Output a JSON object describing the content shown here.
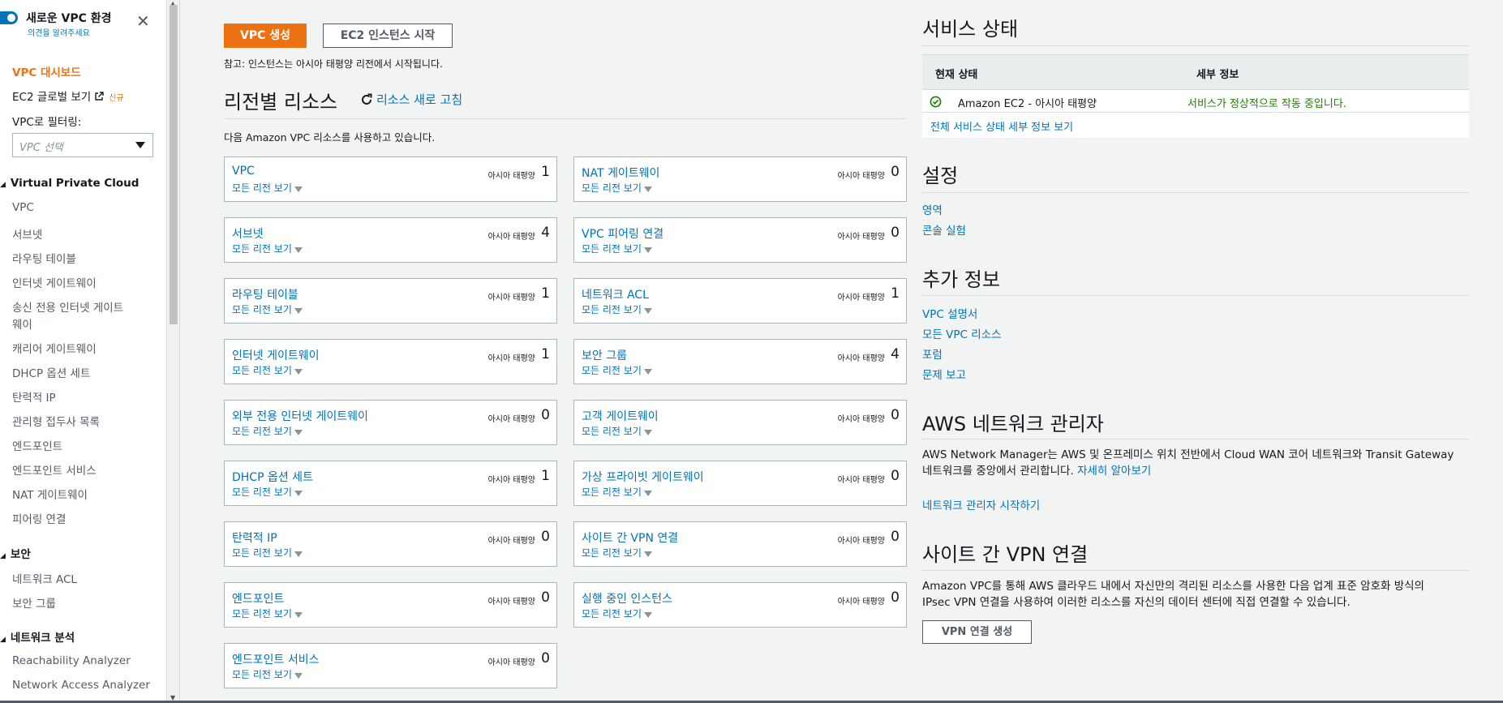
{
  "sidebar": {
    "toggle_label": "새로운 VPC 환경",
    "toggle_sub": "의견을 알려주세요",
    "close": "✕",
    "dashboard": "VPC 대시보드",
    "ec2_global": "EC2 글로벌 보기",
    "new_badge": "신규",
    "filter_label": "VPC로 필터링:",
    "filter_placeholder": "VPC 선택",
    "group_vpc": "Virtual Private Cloud",
    "vpc_items": [
      "VPC",
      "서브넷",
      "라우팅 테이블",
      "인터넷 게이트웨이",
      "송신 전용 인터넷 게이트",
      "웨이",
      "캐리어 게이트웨이",
      "DHCP 옵션 세트",
      "탄력적 IP",
      "관리형 접두사 목록",
      "엔드포인트",
      "엔드포인트 서비스",
      "NAT 게이트웨이",
      "피어링 연결"
    ],
    "group_security": "보안",
    "security_items": [
      "네트워크 ACL",
      "보안 그룹"
    ],
    "group_analysis": "네트워크 분석",
    "analysis_items": [
      "Reachability Analyzer",
      "Network Access Analyzer"
    ]
  },
  "main": {
    "create_vpc": "VPC 생성",
    "launch_ec2": "EC2 인스턴스 시작",
    "note": "참고: 인스턴스는 아시아 태평양 리전에서 시작됩니다.",
    "resources_title": "리전별 리소스",
    "refresh": "리소스 새로 고침",
    "intro": "다음 Amazon VPC 리소스를 사용하고 있습니다.",
    "all_regions": "모든 리전 보기",
    "region": "아시아 태평양",
    "cards_left": [
      {
        "title": "VPC",
        "count": "1"
      },
      {
        "title": "서브넷",
        "count": "4"
      },
      {
        "title": "라우팅 테이블",
        "count": "1"
      },
      {
        "title": "인터넷 게이트웨이",
        "count": "1"
      },
      {
        "title": "외부 전용 인터넷 게이트웨이",
        "count": "0"
      },
      {
        "title": "DHCP 옵션 세트",
        "count": "1"
      },
      {
        "title": "탄력적 IP",
        "count": "0"
      },
      {
        "title": "엔드포인트",
        "count": "0"
      },
      {
        "title": "엔드포인트 서비스",
        "count": "0"
      }
    ],
    "cards_right": [
      {
        "title": "NAT 게이트웨이",
        "count": "0"
      },
      {
        "title": "VPC 피어링 연결",
        "count": "0"
      },
      {
        "title": "네트워크 ACL",
        "count": "1"
      },
      {
        "title": "보안 그룹",
        "count": "4"
      },
      {
        "title": "고객 게이트웨이",
        "count": "0"
      },
      {
        "title": "가상 프라이빗 게이트웨이",
        "count": "0"
      },
      {
        "title": "사이트 간 VPN 연결",
        "count": "0"
      },
      {
        "title": "실행 중인 인스턴스",
        "count": "0"
      }
    ]
  },
  "right": {
    "service_status_title": "서비스 상태",
    "col_status": "현재 상태",
    "col_detail": "세부 정보",
    "service_name": "Amazon EC2 - 아시아 태평양",
    "service_detail": "서비스가 정상적으로 작동 중입니다.",
    "status_link": "전체 서비스 상태 세부 정보 보기",
    "settings_title": "설정",
    "settings_links": [
      "영역",
      "콘솔 실험"
    ],
    "info_title": "추가 정보",
    "info_links": [
      "VPC 설명서",
      "모든 VPC 리소스",
      "포럼",
      "문제 보고"
    ],
    "nm_title": "AWS 네트워크 관리자",
    "nm_text_1": "AWS Network Manager는 AWS 및 온프레미스 위치 전반에서 Cloud WAN 코어 네트워크와 Transit Gateway",
    "nm_text_2": "네트워크를 중앙에서 관리합니다.",
    "nm_learn_more": "자세히 알아보기",
    "nm_start": "네트워크 관리자 시작하기",
    "vpn_title": "사이트 간 VPN 연결",
    "vpn_text_1": "Amazon VPC를 통해 AWS 클라우드 내에서 자신만의 격리된 리소스를 사용한 다음 업계 표준 암호화 방식의",
    "vpn_text_2": "IPsec VPN 연결을 사용하여 이러한 리소스를 자신의 데이터 센터에 직접 연결할 수 있습니다.",
    "vpn_button": "VPN 연결 생성"
  },
  "colors": {
    "accent": "#ec7211",
    "link": "#0073bb",
    "success": "#1d8102"
  },
  "icons": [
    "toggle-switch",
    "close-icon",
    "external-link-icon",
    "chevron-down-icon",
    "refresh-icon",
    "check-circle-icon"
  ]
}
